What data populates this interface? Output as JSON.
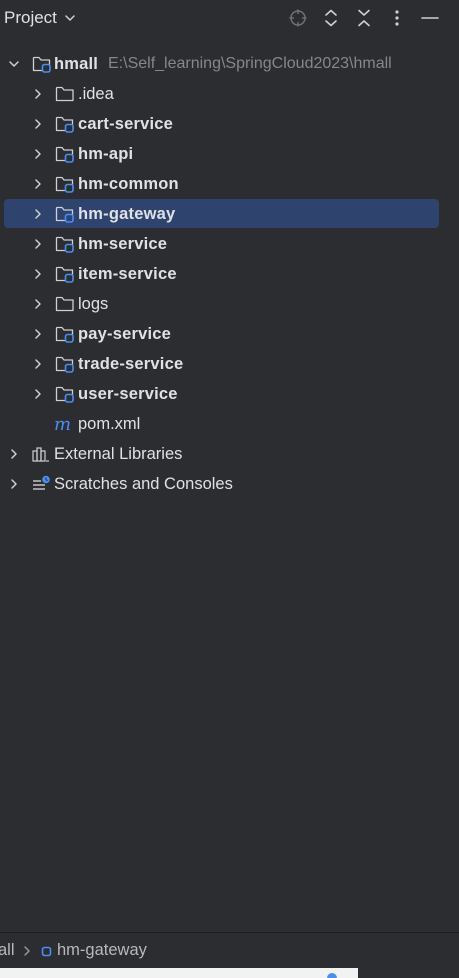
{
  "header": {
    "title": "Project",
    "icons": [
      "locate-icon",
      "expand-all-icon",
      "collapse-all-icon",
      "more-options-icon",
      "minimize-icon"
    ]
  },
  "tree": {
    "root": {
      "name": "hmall",
      "path": "E:\\Self_learning\\SpringCloud2023\\hmall"
    },
    "children": [
      {
        "name": ".idea",
        "type": "folder"
      },
      {
        "name": "cart-service",
        "type": "module"
      },
      {
        "name": "hm-api",
        "type": "module"
      },
      {
        "name": "hm-common",
        "type": "module"
      },
      {
        "name": "hm-gateway",
        "type": "module",
        "selected": true
      },
      {
        "name": "hm-service",
        "type": "module"
      },
      {
        "name": "item-service",
        "type": "module"
      },
      {
        "name": "logs",
        "type": "folder"
      },
      {
        "name": "pay-service",
        "type": "module"
      },
      {
        "name": "trade-service",
        "type": "module"
      },
      {
        "name": "user-service",
        "type": "module"
      },
      {
        "name": "pom.xml",
        "type": "maven-file"
      }
    ],
    "external_libraries": "External Libraries",
    "scratches": "Scratches and Consoles"
  },
  "breadcrumb": {
    "items": [
      "all",
      "hm-gateway"
    ]
  },
  "colors": {
    "background": "#2b2d30",
    "selection": "#2e436e",
    "text": "#dfe1e5",
    "path_text": "#84878c",
    "module_badge": "#4a8ef0"
  }
}
